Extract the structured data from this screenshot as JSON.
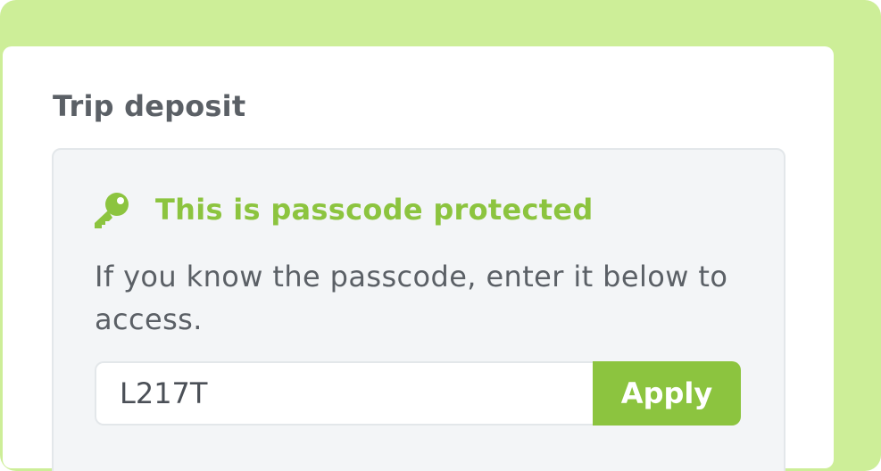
{
  "section": {
    "title": "Trip deposit"
  },
  "protection": {
    "icon": "key-icon",
    "heading": "This is passcode protected",
    "description": "If you know the passcode, enter it below to access."
  },
  "passcode": {
    "value": "L217T",
    "apply_label": "Apply"
  },
  "colors": {
    "background_accent": "#cdee98",
    "brand_green": "#8cc43f",
    "panel_bg": "#f3f5f7",
    "text": "#5b6066"
  }
}
